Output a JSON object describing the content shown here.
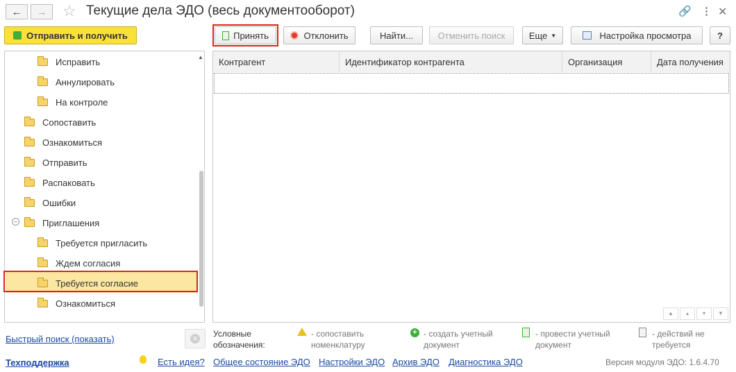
{
  "window": {
    "title": "Текущие дела ЭДО (весь документооборот)"
  },
  "toolbar": {
    "send_receive": "Отправить и получить",
    "accept": "Принять",
    "decline": "Отклонить",
    "find": "Найти...",
    "cancel_search": "Отменить поиск",
    "more": "Еще",
    "view_settings": "Настройка просмотра",
    "help": "?"
  },
  "tree": {
    "items": [
      {
        "label": "Исправить"
      },
      {
        "label": "Аннулировать"
      },
      {
        "label": "На контроле"
      },
      {
        "label": "Сопоставить"
      },
      {
        "label": "Ознакомиться"
      },
      {
        "label": "Отправить"
      },
      {
        "label": "Распаковать"
      },
      {
        "label": "Ошибки"
      },
      {
        "label": "Приглашения"
      },
      {
        "label": "Требуется пригласить"
      },
      {
        "label": "Ждем согласия"
      },
      {
        "label": "Требуется согласие"
      },
      {
        "label": "Ознакомиться"
      }
    ]
  },
  "table": {
    "columns": [
      "Контрагент",
      "Идентификатор контрагента",
      "Организация",
      "Дата получения"
    ]
  },
  "legend": {
    "title": "Условные обозначения:",
    "items": [
      {
        "text": "- сопоставить номенклатуру",
        "icon": "warning-icon",
        "color": "#e8c21a"
      },
      {
        "text": "- создать учетный документ",
        "icon": "plus-circle-icon",
        "color": "#3fae3a"
      },
      {
        "text": "- провести учетный документ",
        "icon": "document-post-icon",
        "color": "#3fae3a"
      },
      {
        "text": "- действий не требуется",
        "icon": "clipboard-icon",
        "color": "#888888"
      }
    ]
  },
  "footer": {
    "quick_search": "Быстрый поиск (показать)",
    "support": "Техподдержка",
    "idea": "Есть идея?",
    "status": "Общее состояние ЭДО",
    "settings": "Настройки ЭДО",
    "archive": "Архив ЭДО",
    "diagnostics": "Диагностика ЭДО",
    "version": "Версия модуля ЭДО: 1.6.4.70"
  },
  "colors": {
    "accent_yellow": "#f9e03a",
    "highlight": "#fbe7a1",
    "red_frame": "#e02020",
    "link": "#1a4aa3"
  }
}
